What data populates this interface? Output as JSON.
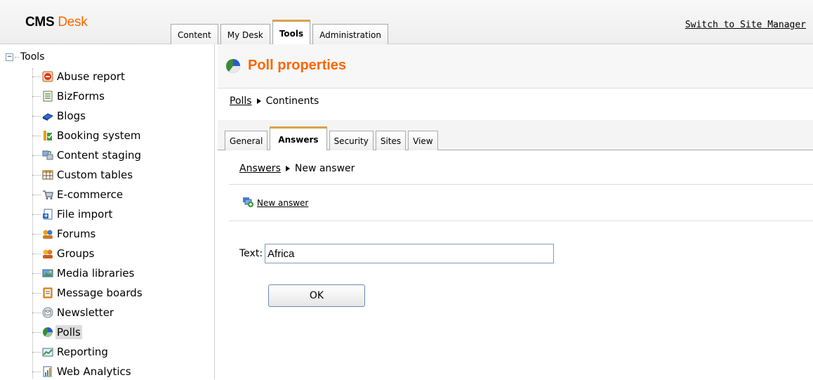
{
  "header": {
    "logo_part1": "CMS",
    "logo_part2": "Desk",
    "tabs": [
      "Content",
      "My Desk",
      "Tools",
      "Administration"
    ],
    "active_tab": "Tools",
    "switch_link": "Switch to Site Manager"
  },
  "tree": {
    "root_label": "Tools",
    "expander": "−",
    "items": [
      {
        "label": "Abuse report",
        "icon": "abuse-report-icon"
      },
      {
        "label": "BizForms",
        "icon": "bizforms-icon"
      },
      {
        "label": "Blogs",
        "icon": "blogs-icon"
      },
      {
        "label": "Booking system",
        "icon": "booking-system-icon"
      },
      {
        "label": "Content staging",
        "icon": "content-staging-icon"
      },
      {
        "label": "Custom tables",
        "icon": "custom-tables-icon"
      },
      {
        "label": "E-commerce",
        "icon": "ecommerce-icon"
      },
      {
        "label": "File import",
        "icon": "file-import-icon"
      },
      {
        "label": "Forums",
        "icon": "forums-icon"
      },
      {
        "label": "Groups",
        "icon": "groups-icon"
      },
      {
        "label": "Media libraries",
        "icon": "media-libraries-icon"
      },
      {
        "label": "Message boards",
        "icon": "message-boards-icon"
      },
      {
        "label": "Newsletter",
        "icon": "newsletter-icon"
      },
      {
        "label": "Polls",
        "icon": "polls-icon"
      },
      {
        "label": "Reporting",
        "icon": "reporting-icon"
      },
      {
        "label": "Web Analytics",
        "icon": "web-analytics-icon"
      }
    ],
    "selected": "Polls"
  },
  "main": {
    "title": "Poll properties",
    "breadcrumb": {
      "link": "Polls",
      "current": "Continents"
    },
    "tabs": [
      "General",
      "Answers",
      "Security",
      "Sites",
      "View"
    ],
    "active_tab": "Answers",
    "sub_breadcrumb": {
      "link": "Answers",
      "current": "New answer"
    },
    "new_answer_label": "New answer",
    "text_label": "Text:",
    "text_value": "Africa",
    "ok_label": "OK"
  },
  "colors": {
    "accent_orange": "#ff6600",
    "active_tab_border": "#f5a623"
  }
}
